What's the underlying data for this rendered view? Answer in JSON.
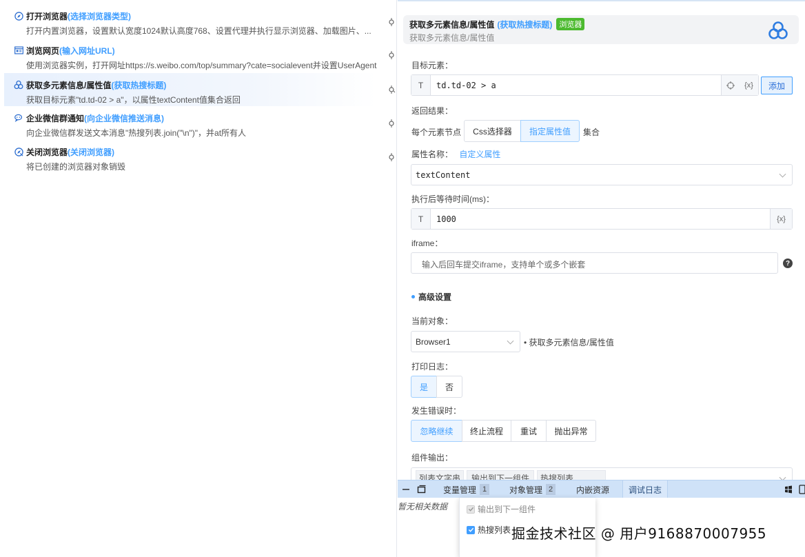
{
  "flow": {
    "steps": [
      {
        "name": "打开浏览器",
        "tag": "(选择浏览器类型)",
        "icon": "compass-icon",
        "desc": "打开内置浏览器，设置默认宽度1024默认高度768、设置代理并执行显示浏览器、加载图片、..."
      },
      {
        "name": "浏览网页",
        "tag": "(输入网址URL)",
        "icon": "webpage-icon",
        "desc": "使用浏览器实例，打开网址https://s.weibo.com/top/summary?cate=socialevent并设置UserAgent"
      },
      {
        "name": "获取多元素信息/属性值",
        "tag": "(获取热搜标题)",
        "icon": "multi-element-icon",
        "desc": "获取目标元素\"td.td-02 > a\"，以属性textContent值集合返回"
      },
      {
        "name": "企业微信群通知",
        "tag": "(向企业微信推送消息)",
        "icon": "wecom-icon",
        "desc": "向企业微信群发送文本消息\"热搜列表.join(\"\\n\")\"，并at所有人"
      },
      {
        "name": "关闭浏览器",
        "tag": "(关闭浏览器)",
        "icon": "close-browser-icon",
        "desc": "将已创建的浏览器对象销毁"
      }
    ]
  },
  "panel": {
    "title": "获取多元素信息/属性值",
    "tag": "(获取热搜标题)",
    "badge": "浏览器",
    "subtitle": "获取多元素信息/属性值",
    "target_label": "目标元素：",
    "target_prefix": "T",
    "target_value": "td.td-02 > a",
    "var_btn": "{x}",
    "add_btn": "添加",
    "result_label": "返回结果：",
    "per_node": "每个元素节点",
    "css_selector": "Css选择器",
    "attr_value": "指定属性值",
    "collection": "集合",
    "attr_name_label": "属性名称：",
    "custom_attr": "自定义属性",
    "attr_name_value": "textContent",
    "wait_label": "执行后等待时间(ms)：",
    "wait_prefix": "T",
    "wait_value": "1000",
    "iframe_label": "iframe：",
    "iframe_placeholder": "输入后回车提交iframe，支持单个或多个嵌套",
    "help": "?",
    "advanced": "高级设置",
    "current_obj_label": "当前对象：",
    "current_obj_value": "Browser1",
    "current_obj_note": "• 获取多元素信息/属性值",
    "log_label": "打印日志：",
    "log_yes": "是",
    "log_no": "否",
    "error_label": "发生错误时：",
    "err_ignore": "忽略继续",
    "err_stop": "终止流程",
    "err_retry": "重试",
    "err_throw": "抛出异常",
    "output_label": "组件输出：",
    "output_partial_1": "列表文字串",
    "output_partial_2": "输出到下一组件",
    "output_partial_3": "热搜列表"
  },
  "bottombar": {
    "tabs": [
      {
        "label": "变量管理",
        "count": "1"
      },
      {
        "label": "对象管理",
        "count": "2"
      },
      {
        "label": "内嵌资源",
        "count": ""
      },
      {
        "label": "调试日志",
        "count": ""
      }
    ],
    "empty": "暂无相关数据"
  },
  "dropdown": {
    "options": [
      {
        "label": "输出到下一组件",
        "state": "disabled"
      },
      {
        "label": "热搜列表",
        "state": "checked"
      }
    ]
  },
  "watermark": "掘金技术社区 @ 用户9168870007955",
  "colors": {
    "accent": "#409eff",
    "badge": "#4cba2f",
    "bottombar": "#cfe2f8"
  }
}
